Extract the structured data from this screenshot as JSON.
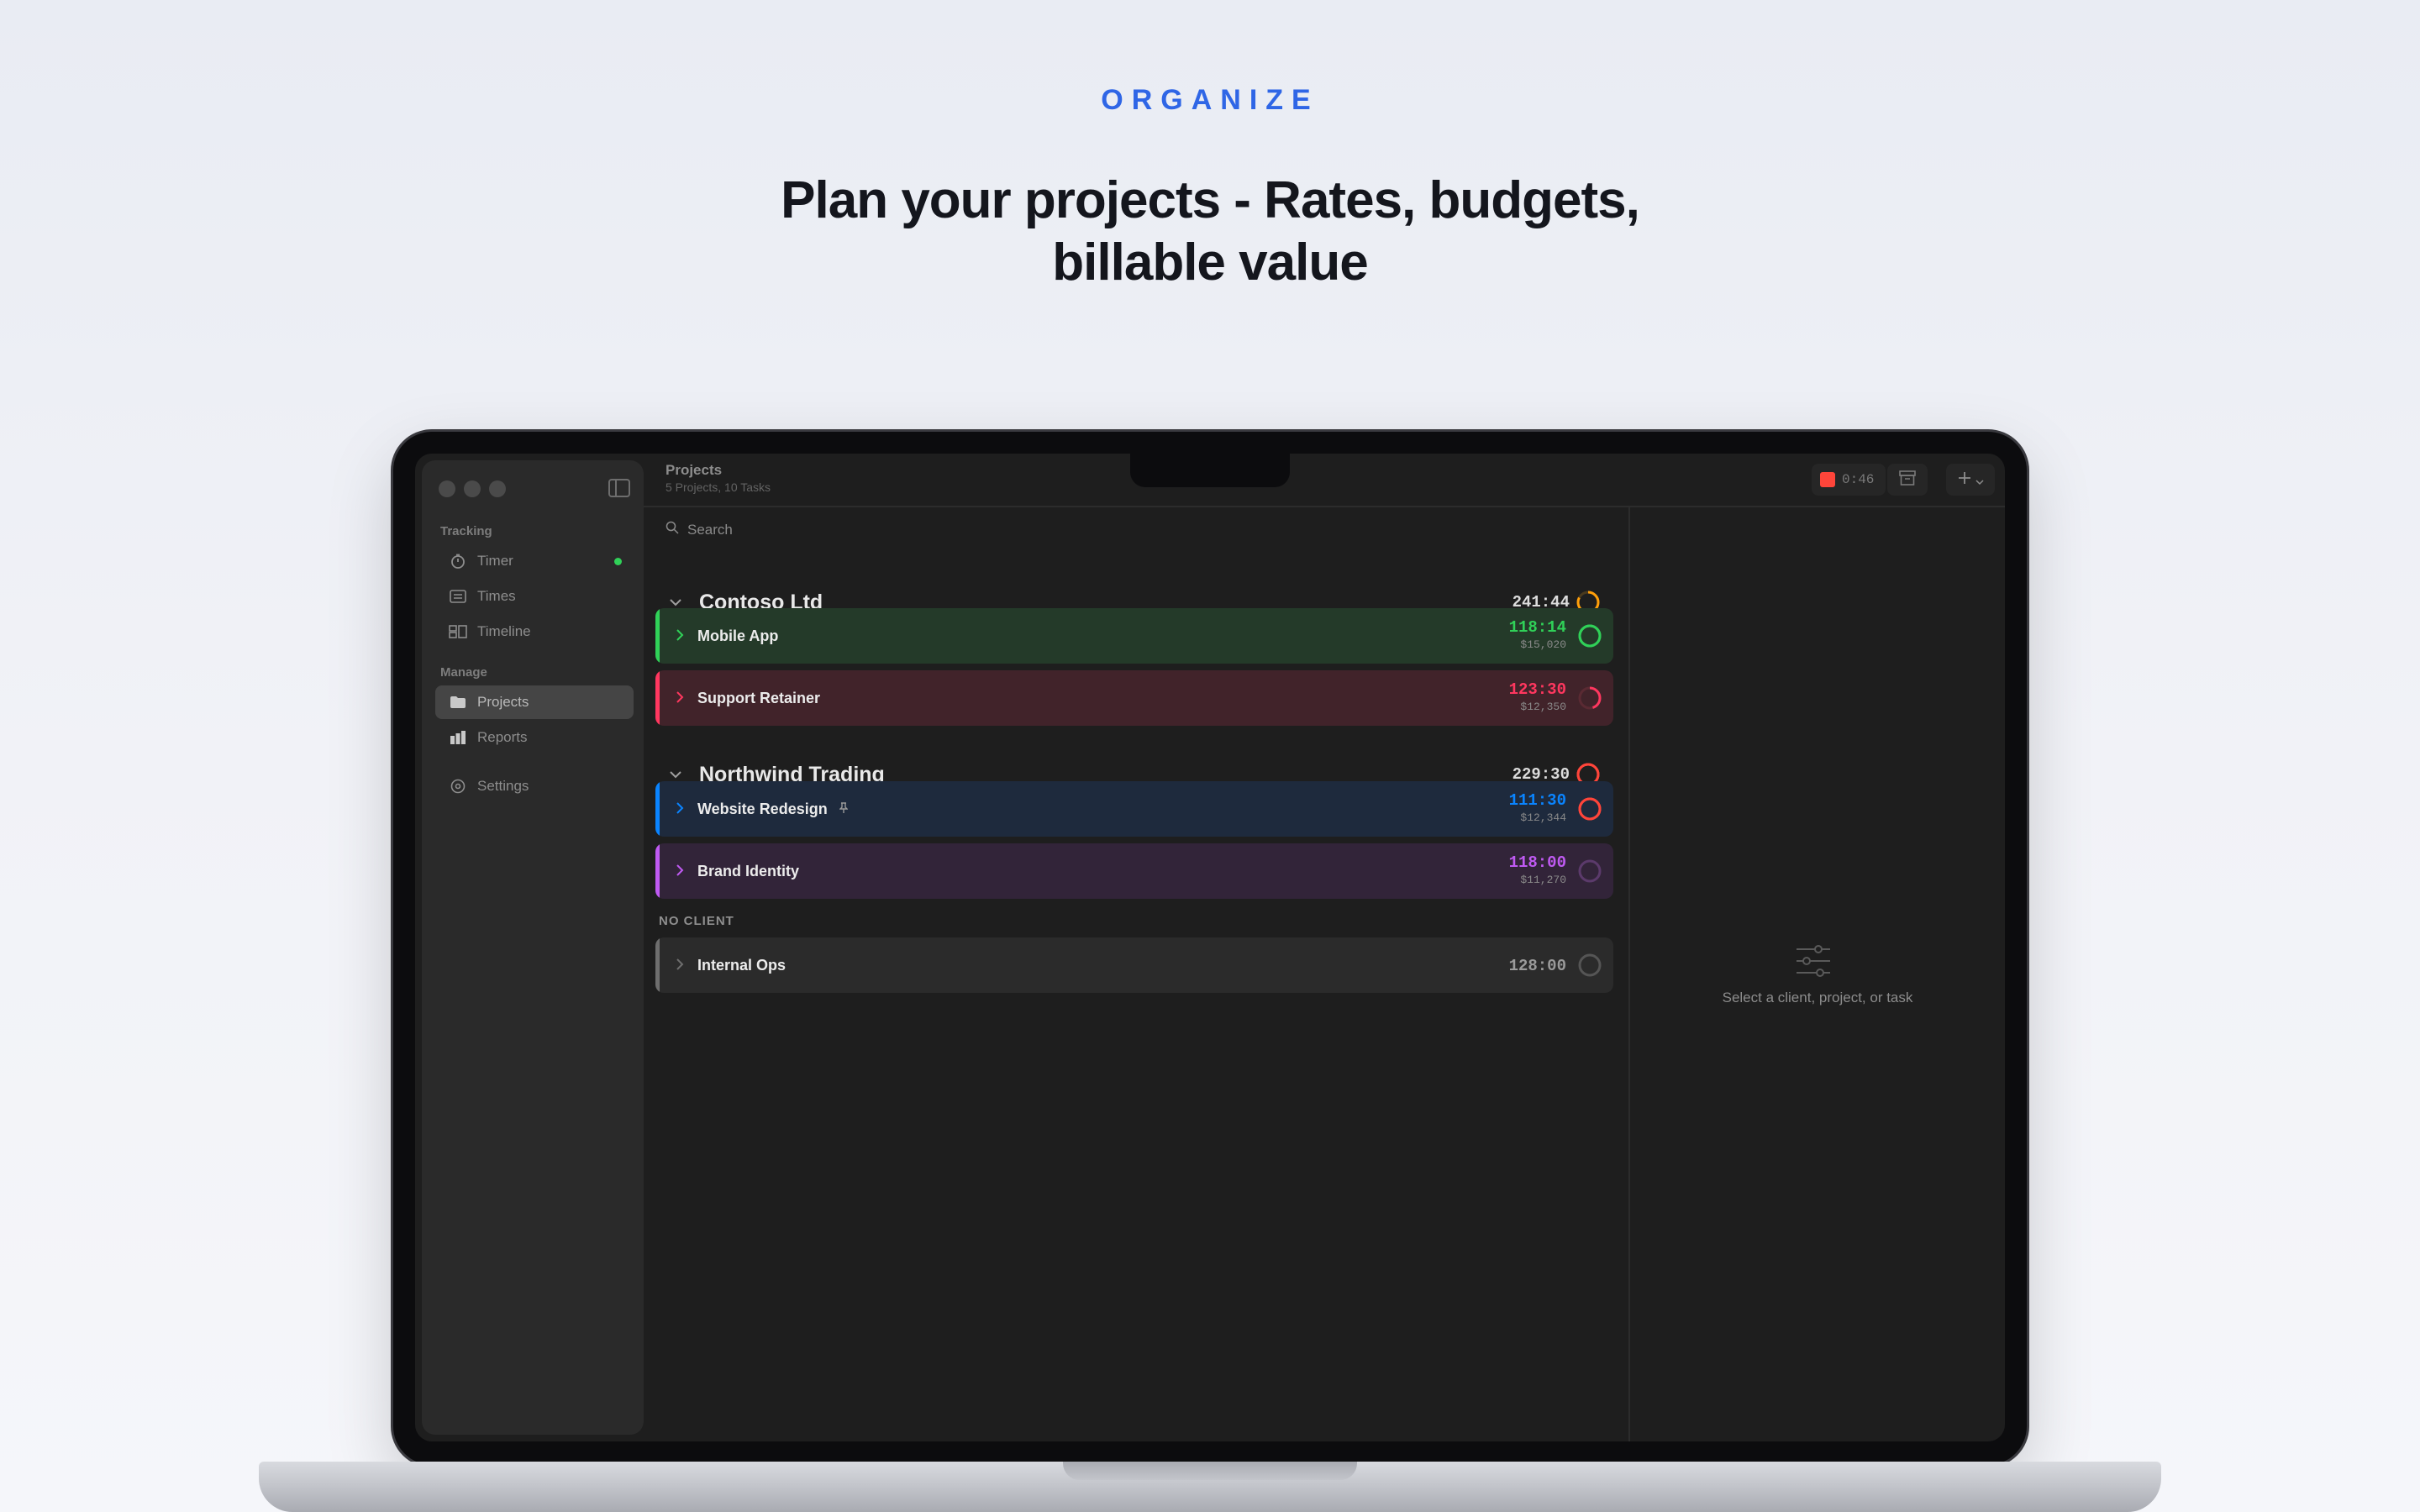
{
  "hero": {
    "eyebrow": "ORGANIZE",
    "headline_line1": "Plan your projects - Rates, budgets,",
    "headline_line2": "billable value"
  },
  "sidebar": {
    "tracking_label": "Tracking",
    "manage_label": "Manage",
    "items": [
      {
        "label": "Timer",
        "icon": "timer-icon",
        "active": false,
        "indicator": "#30d158"
      },
      {
        "label": "Times",
        "icon": "times-list-icon",
        "active": false
      },
      {
        "label": "Timeline",
        "icon": "timeline-icon",
        "active": false
      },
      {
        "label": "Projects",
        "icon": "folder-icon",
        "active": true
      },
      {
        "label": "Reports",
        "icon": "bar-chart-icon",
        "active": false
      },
      {
        "label": "Settings",
        "icon": "gear-icon",
        "active": false
      }
    ]
  },
  "toolbar": {
    "title": "Projects",
    "subtitle": "5 Projects, 10 Tasks",
    "timer": "0:46"
  },
  "search": {
    "placeholder": "Search"
  },
  "clients": [
    {
      "name": "Contoso Ltd",
      "total": "241:44",
      "ring_color": "#ff9f0a",
      "projects": [
        {
          "name": "Mobile App",
          "time": "118:14",
          "amount": "$15,020",
          "color": "#30d158",
          "bg": "#243a29"
        },
        {
          "name": "Support Retainer",
          "time": "123:30",
          "amount": "$12,350",
          "color": "#ff375f",
          "bg": "#41232a"
        }
      ]
    },
    {
      "name": "Northwind Trading",
      "total": "229:30",
      "ring_color": "#ff453a",
      "projects": [
        {
          "name": "Website Redesign",
          "time": "111:30",
          "amount": "$12,344",
          "color": "#0a84ff",
          "bg": "#1e2a3d",
          "pinned": true
        },
        {
          "name": "Brand Identity",
          "time": "118:00",
          "amount": "$11,270",
          "color": "#bf5af2",
          "bg": "#322439"
        }
      ]
    }
  ],
  "no_client": {
    "label": "NO CLIENT",
    "projects": [
      {
        "name": "Internal Ops",
        "time": "128:00",
        "color": "#6e6e6e",
        "bg": "#2b2b2b"
      }
    ]
  },
  "detail": {
    "empty_text": "Select a client, project, or task",
    "icon": "sliders-icon"
  }
}
